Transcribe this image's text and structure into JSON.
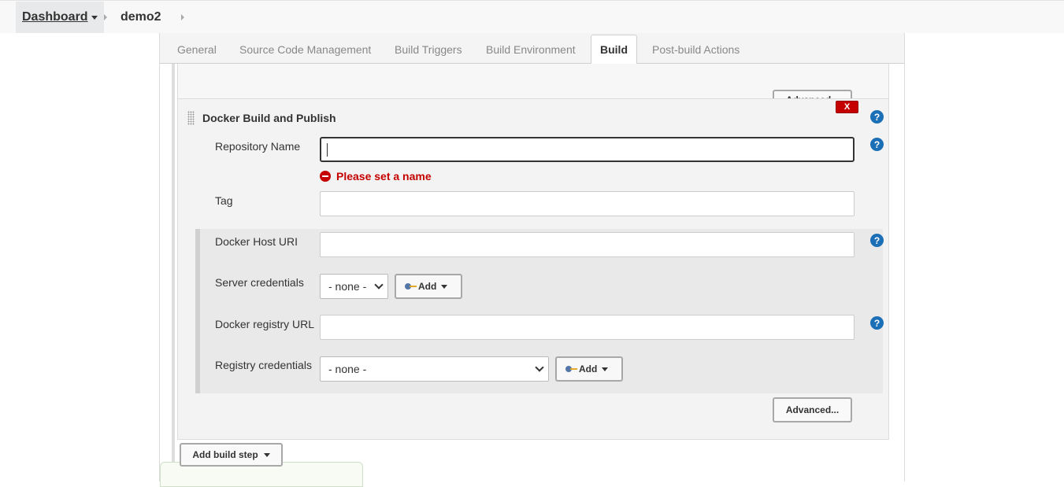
{
  "breadcrumb": {
    "dashboard": "Dashboard",
    "job": "demo2"
  },
  "tabs": [
    {
      "label": "General",
      "active": false
    },
    {
      "label": "Source Code Management",
      "active": false
    },
    {
      "label": "Build Triggers",
      "active": false
    },
    {
      "label": "Build Environment",
      "active": false
    },
    {
      "label": "Build",
      "active": true
    },
    {
      "label": "Post-build Actions",
      "active": false
    }
  ],
  "previous_section": {
    "advanced_button": "Advanced..."
  },
  "docker_step": {
    "title": "Docker Build and Publish",
    "delete_button": "X",
    "help_icon_glyph": "?",
    "repository_name": {
      "label": "Repository Name",
      "value": "",
      "error": "Please set a name"
    },
    "tag": {
      "label": "Tag",
      "value": ""
    },
    "docker_host_uri": {
      "label": "Docker Host URI",
      "value": ""
    },
    "server_credentials": {
      "label": "Server credentials",
      "selected": "- none -",
      "add_button": "Add"
    },
    "docker_registry_url": {
      "label": "Docker registry URL",
      "value": ""
    },
    "registry_credentials": {
      "label": "Registry credentials",
      "selected": "- none -",
      "add_button": "Add"
    },
    "advanced_button": "Advanced..."
  },
  "add_build_step": "Add build step",
  "colors": {
    "error_red": "#c40000",
    "help_blue": "#1a6fb6",
    "key_blue": "#5576a8",
    "key_gold": "#e3a92a"
  }
}
